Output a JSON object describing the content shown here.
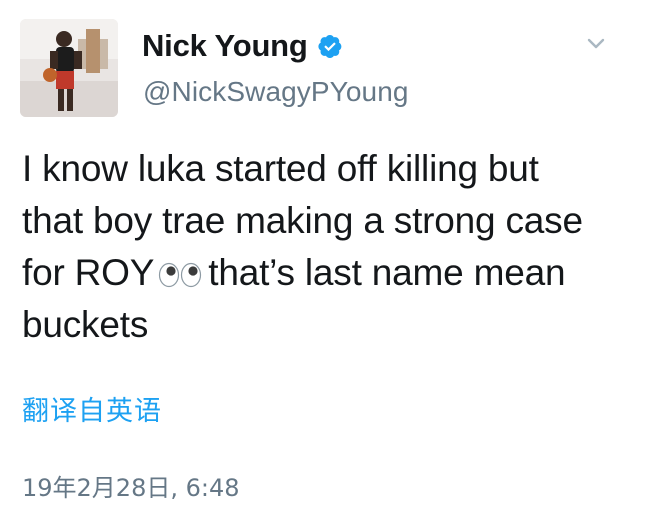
{
  "user": {
    "display_name": "Nick Young",
    "handle": "@NickSwagyPYoung",
    "verified": true
  },
  "tweet": {
    "lines": [
      "I know luka started off killing but",
      "that boy trae making a strong case",
      "for ROY",
      "that’s last name mean",
      "buckets"
    ],
    "emoji": "eyes"
  },
  "translate_label": "翻译自英语",
  "timestamp": "19年2月28日, 6:48",
  "icons": {
    "verified": "verified-badge-icon",
    "menu": "chevron-down-icon"
  },
  "colors": {
    "accent": "#1da1f2",
    "secondary_text": "#657786",
    "primary_text": "#14171a"
  }
}
